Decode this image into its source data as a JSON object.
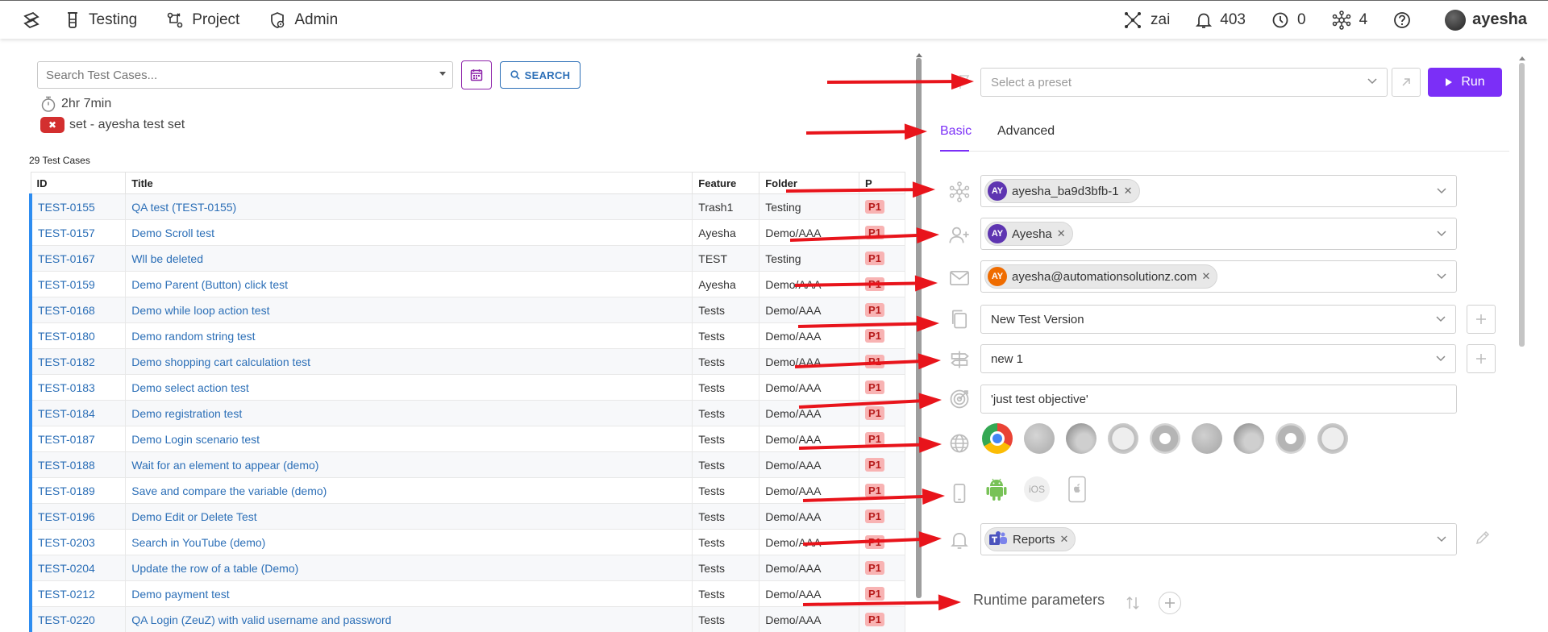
{
  "nav": {
    "items": [
      {
        "label": "Testing",
        "icon": "flask-icon"
      },
      {
        "label": "Project",
        "icon": "project-icon"
      },
      {
        "label": "Admin",
        "icon": "admin-gear-icon"
      }
    ],
    "right": {
      "zai": "zai",
      "notifications": "403",
      "history": "0",
      "nodes": "4",
      "username": "ayesha"
    }
  },
  "left": {
    "search_placeholder": "Search Test Cases...",
    "search_button": "SEARCH",
    "timer": "2hr 7min",
    "set_label": "set - ayesha test set",
    "count_label": "29 Test Cases",
    "columns": [
      "ID",
      "Title",
      "Feature",
      "Folder",
      "P"
    ],
    "rows": [
      {
        "id": "TEST-0155",
        "title": "QA test (TEST-0155)",
        "feature": "Trash1",
        "folder": "Testing",
        "p": "P1"
      },
      {
        "id": "TEST-0157",
        "title": "Demo Scroll test",
        "feature": "Ayesha",
        "folder": "Demo/AAA",
        "p": "P1"
      },
      {
        "id": "TEST-0167",
        "title": "Wll be deleted",
        "feature": "TEST",
        "folder": "Testing",
        "p": "P1"
      },
      {
        "id": "TEST-0159",
        "title": "Demo Parent (Button) click test",
        "feature": "Ayesha",
        "folder": "Demo/AAA",
        "p": "P1"
      },
      {
        "id": "TEST-0168",
        "title": "Demo while loop action test",
        "feature": "Tests",
        "folder": "Demo/AAA",
        "p": "P1"
      },
      {
        "id": "TEST-0180",
        "title": "Demo random string test",
        "feature": "Tests",
        "folder": "Demo/AAA",
        "p": "P1"
      },
      {
        "id": "TEST-0182",
        "title": "Demo shopping cart calculation test",
        "feature": "Tests",
        "folder": "Demo/AAA",
        "p": "P1"
      },
      {
        "id": "TEST-0183",
        "title": "Demo select action test",
        "feature": "Tests",
        "folder": "Demo/AAA",
        "p": "P1"
      },
      {
        "id": "TEST-0184",
        "title": "Demo registration test",
        "feature": "Tests",
        "folder": "Demo/AAA",
        "p": "P1"
      },
      {
        "id": "TEST-0187",
        "title": "Demo Login scenario test",
        "feature": "Tests",
        "folder": "Demo/AAA",
        "p": "P1"
      },
      {
        "id": "TEST-0188",
        "title": "Wait for an element to appear (demo)",
        "feature": "Tests",
        "folder": "Demo/AAA",
        "p": "P1"
      },
      {
        "id": "TEST-0189",
        "title": "Save and compare the variable (demo)",
        "feature": "Tests",
        "folder": "Demo/AAA",
        "p": "P1"
      },
      {
        "id": "TEST-0196",
        "title": "Demo Edit or Delete Test",
        "feature": "Tests",
        "folder": "Demo/AAA",
        "p": "P1"
      },
      {
        "id": "TEST-0203",
        "title": "Search in YouTube (demo)",
        "feature": "Tests",
        "folder": "Demo/AAA",
        "p": "P1"
      },
      {
        "id": "TEST-0204",
        "title": "Update the row of a table (Demo)",
        "feature": "Tests",
        "folder": "Demo/AAA",
        "p": "P1"
      },
      {
        "id": "TEST-0212",
        "title": "Demo payment test",
        "feature": "Tests",
        "folder": "Demo/AAA",
        "p": "P1"
      },
      {
        "id": "TEST-0220",
        "title": "QA Login (ZeuZ) with valid username and password",
        "feature": "Tests",
        "folder": "Demo/AAA",
        "p": "P1"
      }
    ]
  },
  "right": {
    "preset_placeholder": "Select a preset",
    "run_label": "Run",
    "tabs": [
      "Basic",
      "Advanced"
    ],
    "node_chip": {
      "initials": "AY",
      "label": "ayesha_ba9d3bfb-1"
    },
    "assignee_chip": {
      "initials": "AY",
      "label": "Ayesha"
    },
    "email_chip": {
      "initials": "AY",
      "label": "ayesha@automationsolutionz.com"
    },
    "version": "New Test Version",
    "milestone": "new 1",
    "objective": "'just test objective'",
    "ios_label": "iOS",
    "notify_chip": {
      "label": "Reports"
    },
    "runtime_label": "Runtime parameters"
  },
  "colors": {
    "accent": "#7b2ff7",
    "link": "#2c6fb7",
    "row_marker": "#2d8cf0",
    "priority_bg": "#f8b3b3",
    "arrow": "#e8141b"
  }
}
